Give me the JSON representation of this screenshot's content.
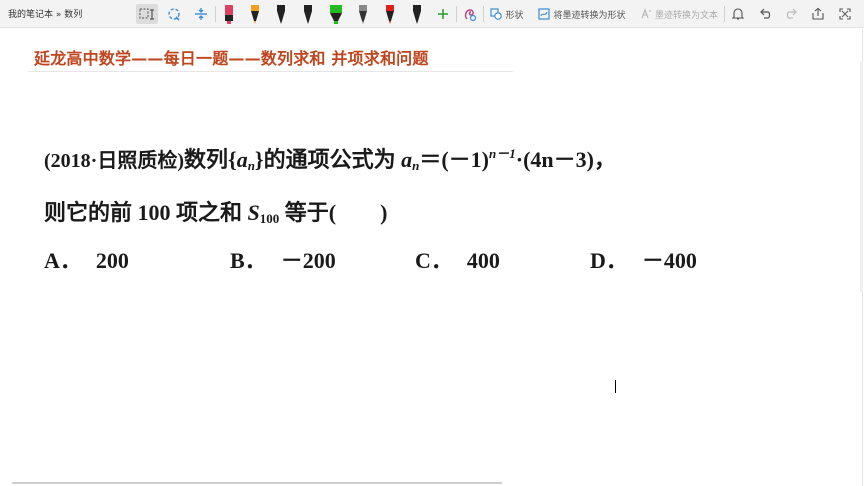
{
  "app": {
    "breadcrumb": "我的笔记本 » 数列"
  },
  "toolbar": {
    "shape_label": "形状",
    "ink_to_shape_label": "将墨迹转换为形状",
    "ink_to_text_label": "墨迹转换为文本",
    "pen_colors": [
      "#e04060",
      "#f0a020",
      "#222222",
      "#222222",
      "#22bb22",
      "#222222",
      "#444444",
      "#e02020",
      "#222222"
    ]
  },
  "page": {
    "title": "延龙高中数学——每日一题——数列求和 并项求和问题"
  },
  "problem": {
    "source": "(2018·日照质检)",
    "stem_a": "数列",
    "seq_var": "a",
    "seq_sub": "n",
    "stem_b": "的通项公式为",
    "formula_lhs_var": "a",
    "formula_lhs_sub": "n",
    "formula_eq": "＝(－1)",
    "formula_exp": "n－1",
    "formula_rest": "·(4n－3)，",
    "line2_a": "则它的前 100 项之和",
    "sum_var": "S",
    "sum_sub": "100",
    "line2_b": "等于(　　)",
    "options": [
      {
        "letter": "A．",
        "value": "200"
      },
      {
        "letter": "B．",
        "value": "－200"
      },
      {
        "letter": "C．",
        "value": "400"
      },
      {
        "letter": "D．",
        "value": "－400"
      }
    ]
  }
}
